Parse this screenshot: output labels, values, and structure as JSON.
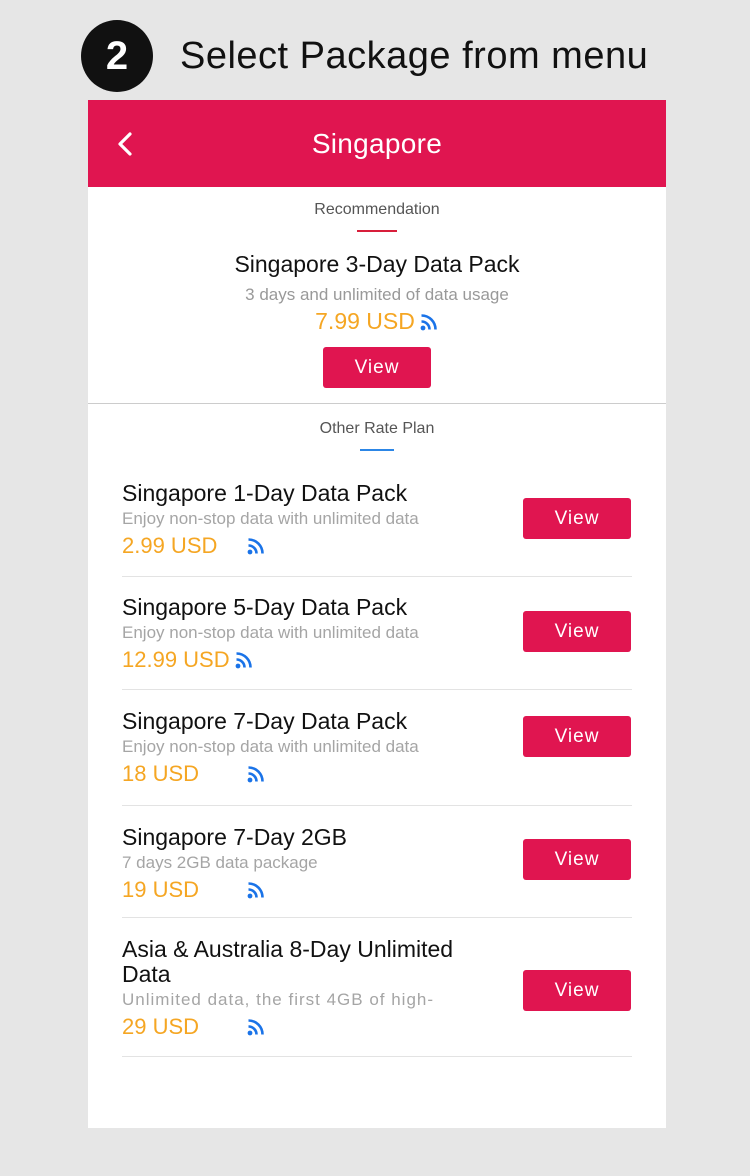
{
  "step": {
    "number": "2",
    "title": "Select Package from menu"
  },
  "topbar": {
    "title": "Singapore"
  },
  "recommendation": {
    "label": "Recommendation",
    "name": "Singapore 3-Day Data Pack",
    "description": "3 days and unlimited of data usage",
    "price": "7.99 USD",
    "button": "View"
  },
  "other": {
    "label": "Other Rate Plan",
    "plans": [
      {
        "name": "Singapore 1-Day Data Pack",
        "description": "Enjoy non-stop data with unlimited data",
        "price": "2.99 USD",
        "button": "View"
      },
      {
        "name": "Singapore 5-Day Data Pack",
        "description": "Enjoy non-stop data with unlimited data",
        "price": "12.99 USD",
        "button": "View"
      },
      {
        "name": "Singapore 7-Day Data Pack",
        "description": "Enjoy non-stop data with unlimited data",
        "price": "18 USD",
        "button": "View"
      },
      {
        "name": "Singapore 7-Day 2GB",
        "description": "7 days 2GB data package",
        "price": "19 USD",
        "button": "View"
      },
      {
        "name": "Asia & Australia 8-Day Unlimited Data",
        "description": "Unlimited data, the first 4GB of high-",
        "price": "29 USD",
        "button": "View"
      }
    ]
  },
  "colors": {
    "brand": "#e01550",
    "price": "#f5a623",
    "wifi": "#1a73e8"
  },
  "icons": {
    "back": "chevron-left-icon",
    "network": "wifi-signal-icon"
  }
}
